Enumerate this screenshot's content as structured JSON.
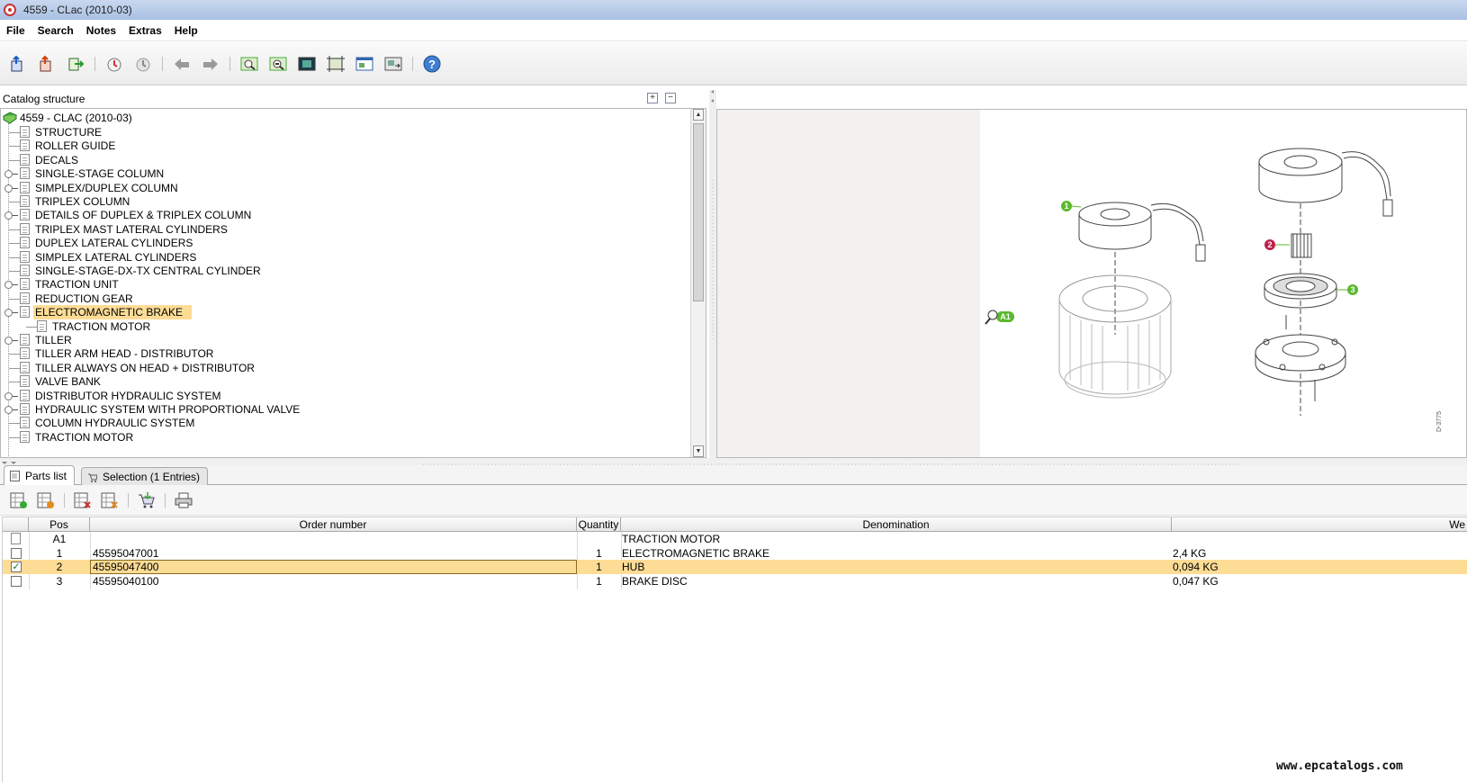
{
  "window": {
    "title": "4559 - CLac (2010-03)"
  },
  "menu": [
    "File",
    "Search",
    "Notes",
    "Extras",
    "Help"
  ],
  "toolbar_icons": [
    "nav-home-icon",
    "nav-up-icon",
    "nav-export-icon",
    "history-back-icon",
    "history-forward-icon",
    "undo-icon",
    "redo-icon",
    "zoom-in-icon",
    "zoom-out-icon",
    "fit-image-icon",
    "fit-frame-icon",
    "window-icon",
    "swap-icon",
    "help-icon"
  ],
  "catalog": {
    "heading": "Catalog structure",
    "root": "4559 - CLAC (2010-03)",
    "items": [
      {
        "label": "STRUCTURE",
        "expandable": false
      },
      {
        "label": "ROLLER GUIDE",
        "expandable": false
      },
      {
        "label": "DECALS",
        "expandable": false
      },
      {
        "label": "SINGLE-STAGE COLUMN",
        "expandable": true
      },
      {
        "label": "SIMPLEX/DUPLEX COLUMN",
        "expandable": true
      },
      {
        "label": "TRIPLEX COLUMN",
        "expandable": false
      },
      {
        "label": "DETAILS OF DUPLEX & TRIPLEX COLUMN",
        "expandable": true
      },
      {
        "label": "TRIPLEX MAST LATERAL CYLINDERS",
        "expandable": false
      },
      {
        "label": "DUPLEX LATERAL CYLINDERS",
        "expandable": false
      },
      {
        "label": "SIMPLEX LATERAL CYLINDERS",
        "expandable": false
      },
      {
        "label": "SINGLE-STAGE-DX-TX CENTRAL CYLINDER",
        "expandable": false
      },
      {
        "label": "TRACTION UNIT",
        "expandable": true
      },
      {
        "label": "REDUCTION GEAR",
        "expandable": false
      },
      {
        "label": "ELECTROMAGNETIC BRAKE",
        "expandable": true,
        "selected": true
      },
      {
        "label": "TRACTION MOTOR",
        "child": true
      },
      {
        "label": "TILLER",
        "expandable": true
      },
      {
        "label": "TILLER ARM HEAD - DISTRIBUTOR",
        "expandable": false
      },
      {
        "label": "TILLER ALWAYS ON HEAD + DISTRIBUTOR",
        "expandable": false
      },
      {
        "label": "VALVE BANK",
        "expandable": false
      },
      {
        "label": "DISTRIBUTOR HYDRAULIC SYSTEM",
        "expandable": true
      },
      {
        "label": "HYDRAULIC SYSTEM WITH PROPORTIONAL VALVE",
        "expandable": true
      },
      {
        "label": "COLUMN HYDRAULIC SYSTEM",
        "expandable": false
      },
      {
        "label": "TRACTION MOTOR",
        "expandable": false
      }
    ]
  },
  "drawing": {
    "callouts": [
      "1",
      "2",
      "3",
      "A1"
    ],
    "code": "D-3775"
  },
  "tabs": [
    {
      "label": "Parts list",
      "active": true
    },
    {
      "label": "Selection (1 Entries)",
      "active": false
    }
  ],
  "parts_toolbar_icons": [
    "add-to-selection-icon",
    "add-all-icon",
    "remove-icon",
    "remove-all-icon",
    "cart-icon",
    "print-icon"
  ],
  "parts": {
    "columns": [
      "Pos",
      "Order number",
      "Quantity",
      "Denomination",
      "We"
    ],
    "rows": [
      {
        "checkbox": "doc",
        "pos": "A1",
        "order": "",
        "qty": "",
        "denomination": "TRACTION MOTOR",
        "weight": ""
      },
      {
        "checkbox": "off",
        "pos": "1",
        "order": "45595047001",
        "qty": "1",
        "denomination": "ELECTROMAGNETIC BRAKE",
        "weight": "2,4 KG"
      },
      {
        "checkbox": "on",
        "pos": "2",
        "order": "45595047400",
        "qty": "1",
        "denomination": "HUB",
        "weight": "0,094 KG",
        "selected": true
      },
      {
        "checkbox": "off",
        "pos": "3",
        "order": "45595040100",
        "qty": "1",
        "denomination": "BRAKE DISC",
        "weight": "0,047 KG"
      }
    ]
  },
  "watermark": "www.epcatalogs.com"
}
